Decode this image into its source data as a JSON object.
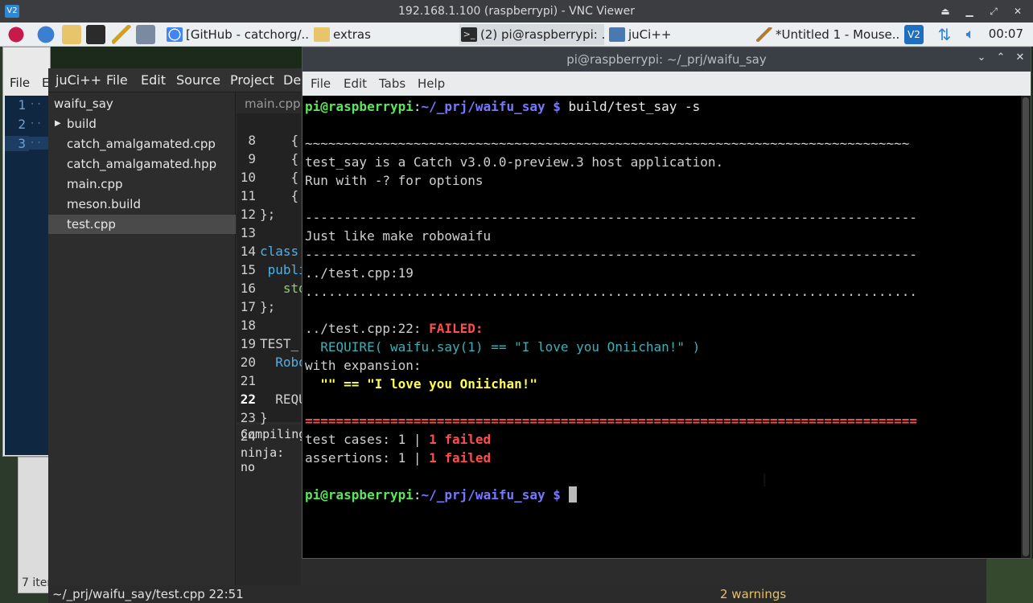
{
  "vnc": {
    "title": "192.168.1.100 (raspberrypi) - VNC Viewer",
    "logo": "V2"
  },
  "taskbar": {
    "tasks": [
      {
        "label": "[GitHub - catchorg/..."
      },
      {
        "label": "extras"
      },
      {
        "label": "(2) pi@raspberrypi: ..."
      },
      {
        "label": "juCi++"
      },
      {
        "label": "*Untitled 1 - Mouse..."
      }
    ],
    "clock": "00:07"
  },
  "mousepad": {
    "menu_file": "File",
    "menu_edit_partial": "E",
    "line_numbers": [
      "1",
      "2",
      "3"
    ]
  },
  "filemgr": {
    "status": "7 iter"
  },
  "juci": {
    "menu": [
      "juCi++",
      "File",
      "Edit",
      "Source",
      "Project",
      "De"
    ],
    "tree": {
      "root": "waifu_say",
      "items": [
        "build",
        "catch_amalgamated.cpp",
        "catch_amalgamated.hpp",
        "main.cpp",
        "meson.build",
        "test.cpp"
      ]
    },
    "tab": "main.cpp",
    "lines": [
      {
        "n": "8",
        "code": "    {"
      },
      {
        "n": "9",
        "code": "    {"
      },
      {
        "n": "10",
        "code": "    {"
      },
      {
        "n": "11",
        "code": "    {"
      },
      {
        "n": "12",
        "code": "};"
      },
      {
        "n": "13",
        "code": ""
      },
      {
        "n": "14",
        "code": "class"
      },
      {
        "n": "15",
        "code": " publi"
      },
      {
        "n": "16",
        "code": "   std"
      },
      {
        "n": "17",
        "code": "};"
      },
      {
        "n": "18",
        "code": ""
      },
      {
        "n": "19",
        "code": "TEST_"
      },
      {
        "n": "20",
        "code": "  Robo"
      },
      {
        "n": "21",
        "code": ""
      },
      {
        "n": "22",
        "code": "  REQU"
      },
      {
        "n": "23",
        "code": "}"
      },
      {
        "n": "24",
        "code": ""
      }
    ],
    "term_lines": [
      "Compiling",
      "ninja: no"
    ],
    "status_path": "~/_prj/waifu_say/test.cpp 22:51",
    "status_warnings": "2 warnings"
  },
  "terminal": {
    "title": "pi@raspberrypi: ~/_prj/waifu_say",
    "menu": [
      "File",
      "Edit",
      "Tabs",
      "Help"
    ],
    "prompt_user": "pi@raspberrypi",
    "prompt_sep": ":",
    "prompt_path": "~/_prj/waifu_say $",
    "command": " build/test_say -s",
    "tilde_rule": "~~~~~~~~~~~~~~~~~~~~~~~~~~~~~~~~~~~~~~~~~~~~~~~~~~~~~~~~~~~~~~~~~~~~~~~~~~~~~~",
    "host_line": "test_say is a Catch v3.0.0-preview.3 host application.",
    "run_line": "Run with -? for options",
    "dash_rule": "-------------------------------------------------------------------------------",
    "test_name": "Just like make robowaifu",
    "test_loc": "../test.cpp:19",
    "dot_rule": "...............................................................................",
    "fail_loc": "../test.cpp:22: ",
    "failed_word": "FAILED:",
    "require_line": "  REQUIRE( waifu.say(1) == \"I love you Oniichan!\" )",
    "with_expansion": "with expansion:",
    "expansion": "  \"\" == \"I love you Oniichan!\"",
    "eq_rule": "===============================================================================",
    "cases_prefix": "test cases: 1 | ",
    "cases_failed": "1 failed",
    "asserts_prefix": "assertions: 1 | ",
    "asserts_failed": "1 failed"
  }
}
